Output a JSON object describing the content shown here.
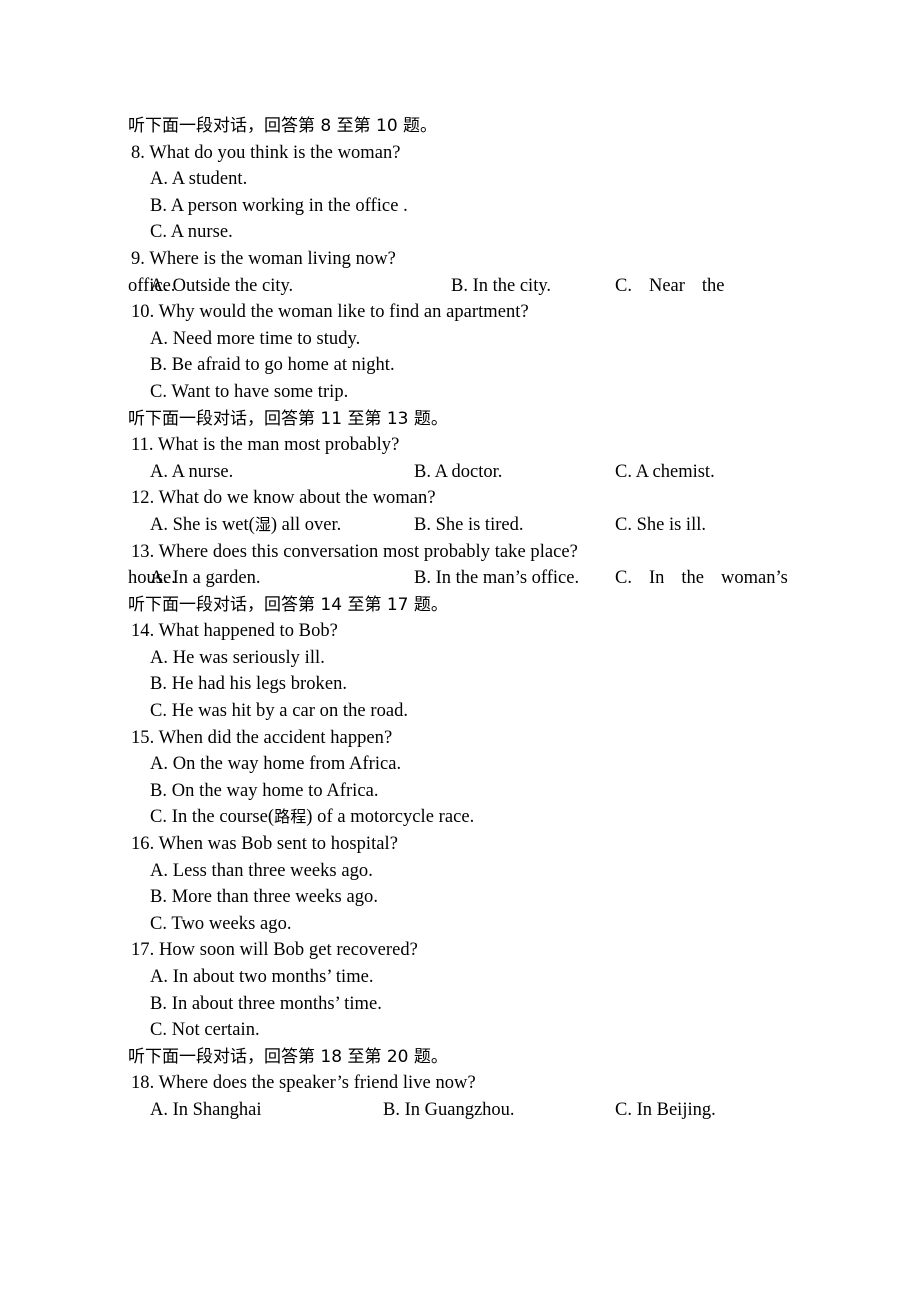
{
  "document": {
    "type": "listening-comprehension-exam",
    "language": "en-zh"
  },
  "blocks": [
    {
      "heading": "听下面一段对话，回答第 8 至第 10 题。",
      "questions": [
        {
          "stem": "8. What do you think is the woman?",
          "layout": "stacked",
          "options": [
            "A. A student.",
            "B. A person working in the office .",
            "C. A nurse."
          ]
        },
        {
          "stem": "9. Where is the woman living now?",
          "layout": "justified-wrap",
          "optionA": "A. Outside the city.",
          "optionB": "B. In the city.",
          "optionC_letter": "C.",
          "optionC_words": [
            "Near",
            "the"
          ],
          "optionC_tail": "office."
        },
        {
          "stem": "10. Why would the woman like to find an apartment?",
          "layout": "stacked",
          "options": [
            "A. Need more time to study.",
            "B. Be afraid to go home at night.",
            "C. Want to have some trip."
          ]
        }
      ]
    },
    {
      "heading": "听下面一段对话，回答第 11 至第 13 题。",
      "questions": [
        {
          "stem": "11. What is the man most probably?",
          "layout": "columns",
          "columns": [
            "A. A nurse.",
            "B. A doctor.",
            "C. A chemist."
          ]
        },
        {
          "stem": "12. What do we know about the woman?",
          "layout": "columns-gloss",
          "colA_pre": "A. She is wet(",
          "colA_gloss": "湿",
          "colA_post": ") all over.",
          "colB": "B. She is tired.",
          "colC": "C. She is ill."
        },
        {
          "stem": "13. Where does this conversation most probably take place?",
          "layout": "justified-wrap",
          "optionA": "A. In a garden.",
          "optionB": "B. In the man’s office.",
          "optionC_letter": "C.",
          "optionC_words": [
            "In",
            "the",
            "woman’s"
          ],
          "optionC_tail": "house."
        }
      ]
    },
    {
      "heading": "听下面一段对话，回答第 14 至第 17 题。",
      "questions": [
        {
          "stem": "14. What happened to Bob?",
          "layout": "stacked",
          "options": [
            "A. He was seriously ill.",
            "B. He had his legs broken.",
            "C. He was hit by a car on the road."
          ]
        },
        {
          "stem": "15. When did the accident happen?",
          "layout": "stacked-gloss",
          "options": [
            "A. On the way home from Africa.",
            "B. On the way home to Africa."
          ],
          "optC_pre": "C. In the course(",
          "optC_gloss": "路程",
          "optC_post": ") of a motorcycle race."
        },
        {
          "stem": "16. When was Bob sent to hospital?",
          "layout": "stacked",
          "options": [
            "A. Less than three weeks ago.",
            "B. More than three weeks ago.",
            "C. Two weeks ago."
          ]
        },
        {
          "stem": "17. How soon will Bob get recovered?",
          "layout": "stacked",
          "options": [
            "A. In about two months’ time.",
            "B. In about three months’ time.",
            "C. Not certain."
          ]
        }
      ]
    },
    {
      "heading": "听下面一段对话，回答第 18 至第 20 题。",
      "questions": [
        {
          "stem": "18. Where does the speaker’s friend live now?",
          "layout": "columns",
          "columns": [
            "A. In Shanghai",
            "B. In Guangzhou.",
            "C. In Beijing."
          ]
        }
      ]
    }
  ]
}
